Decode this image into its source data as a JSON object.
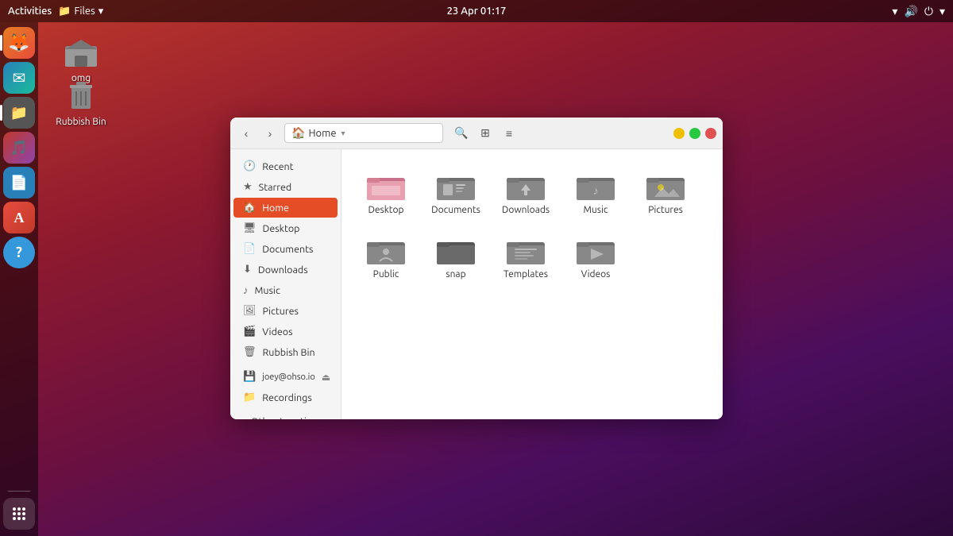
{
  "topbar": {
    "activities": "Activities",
    "files_menu": "Files",
    "datetime": "23 Apr  01:17"
  },
  "desktop": {
    "icons": [
      {
        "id": "omg",
        "label": "omg",
        "type": "home"
      },
      {
        "id": "rubbish",
        "label": "Rubbish Bin",
        "type": "trash"
      }
    ]
  },
  "dock": {
    "items": [
      {
        "id": "firefox",
        "label": "Firefox",
        "color": "#e67e22",
        "icon": "🦊"
      },
      {
        "id": "thunderbird",
        "label": "Thunderbird",
        "color": "#2980b9",
        "icon": "🐦"
      },
      {
        "id": "files",
        "label": "Files",
        "color": "#555",
        "icon": "📁",
        "active": true
      },
      {
        "id": "rhythmbox",
        "label": "Rhythmbox",
        "color": "#c0392b",
        "icon": "🎵"
      },
      {
        "id": "writer",
        "label": "Writer",
        "color": "#2980b9",
        "icon": "📄"
      },
      {
        "id": "appstore",
        "label": "App Store",
        "color": "#e74c3c",
        "icon": "🅐"
      },
      {
        "id": "help",
        "label": "Help",
        "color": "#3498db",
        "icon": "?"
      }
    ],
    "apps_grid": "Show Applications"
  },
  "file_manager": {
    "title": "Home",
    "location": "Home",
    "sidebar": {
      "items": [
        {
          "id": "recent",
          "label": "Recent",
          "icon": "🕐"
        },
        {
          "id": "starred",
          "label": "Starred",
          "icon": "★"
        },
        {
          "id": "home",
          "label": "Home",
          "icon": "🏠",
          "active": true
        },
        {
          "id": "desktop",
          "label": "Desktop",
          "icon": "🖥"
        },
        {
          "id": "documents",
          "label": "Documents",
          "icon": "📄"
        },
        {
          "id": "downloads",
          "label": "Downloads",
          "icon": "⬇"
        },
        {
          "id": "music",
          "label": "Music",
          "icon": "🎵"
        },
        {
          "id": "pictures",
          "label": "Pictures",
          "icon": "🖼"
        },
        {
          "id": "videos",
          "label": "Videos",
          "icon": "🎬"
        },
        {
          "id": "rubbish",
          "label": "Rubbish Bin",
          "icon": "🗑"
        },
        {
          "id": "joey",
          "label": "joey@ohso.io",
          "icon": "💾",
          "eject": true
        },
        {
          "id": "recordings",
          "label": "Recordings",
          "icon": "📁"
        },
        {
          "id": "other",
          "label": "+ Other Locations",
          "icon": ""
        }
      ]
    },
    "folders": [
      {
        "id": "desktop",
        "label": "Desktop",
        "color": "pink"
      },
      {
        "id": "documents",
        "label": "Documents",
        "color": "gray"
      },
      {
        "id": "downloads",
        "label": "Downloads",
        "color": "gray"
      },
      {
        "id": "music",
        "label": "Music",
        "color": "gray"
      },
      {
        "id": "pictures",
        "label": "Pictures",
        "color": "gray"
      },
      {
        "id": "public",
        "label": "Public",
        "color": "gray"
      },
      {
        "id": "snap",
        "label": "snap",
        "color": "darkgray"
      },
      {
        "id": "templates",
        "label": "Templates",
        "color": "gray"
      },
      {
        "id": "videos",
        "label": "Videos",
        "color": "gray"
      }
    ],
    "wm": {
      "minimize": "−",
      "maximize": "□",
      "close": "×"
    }
  }
}
